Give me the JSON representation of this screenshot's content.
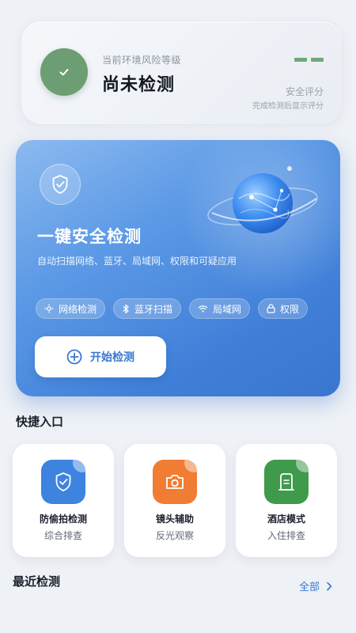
{
  "status": {
    "circle_color": "#6d9d72",
    "icon": "checkmark-icon",
    "subtitle": "当前环境风险等级",
    "title": "尚未检测",
    "score_placeholder": "--",
    "score_label": "安全评分",
    "score_hint": "完成检测后显示评分"
  },
  "hero": {
    "shield_icon": "shield-check-icon",
    "globe_icon": "globe-illustration",
    "title": "一键安全检测",
    "description": "自动扫描网络、蓝牙、局域网、权限和可疑应用",
    "chips": [
      {
        "label": "网络检测",
        "icon": "network-icon"
      },
      {
        "label": "蓝牙扫描",
        "icon": "bluetooth-icon"
      },
      {
        "label": "局域网",
        "icon": "wifi-icon"
      },
      {
        "label": "权限",
        "icon": "lock-icon"
      }
    ],
    "start_button": {
      "label": "开始检测",
      "icon": "plus-circle-icon"
    }
  },
  "quick": {
    "title": "快捷入口",
    "items": [
      {
        "name": "防偷拍检测",
        "sub": "综合排查",
        "icon": "shield-check-icon",
        "color": "#3d83df"
      },
      {
        "name": "镜头辅助",
        "sub": "反光观察",
        "icon": "camera-icon",
        "color": "#f07d33"
      },
      {
        "name": "酒店模式",
        "sub": "入住排查",
        "icon": "door-icon",
        "color": "#3f9a4c"
      }
    ]
  },
  "recent": {
    "title": "最近检测",
    "all_label": "全部",
    "all_icon": "chevron-right-icon"
  },
  "colors": {
    "accent": "#3a78cf",
    "background": "#eef1f6"
  }
}
